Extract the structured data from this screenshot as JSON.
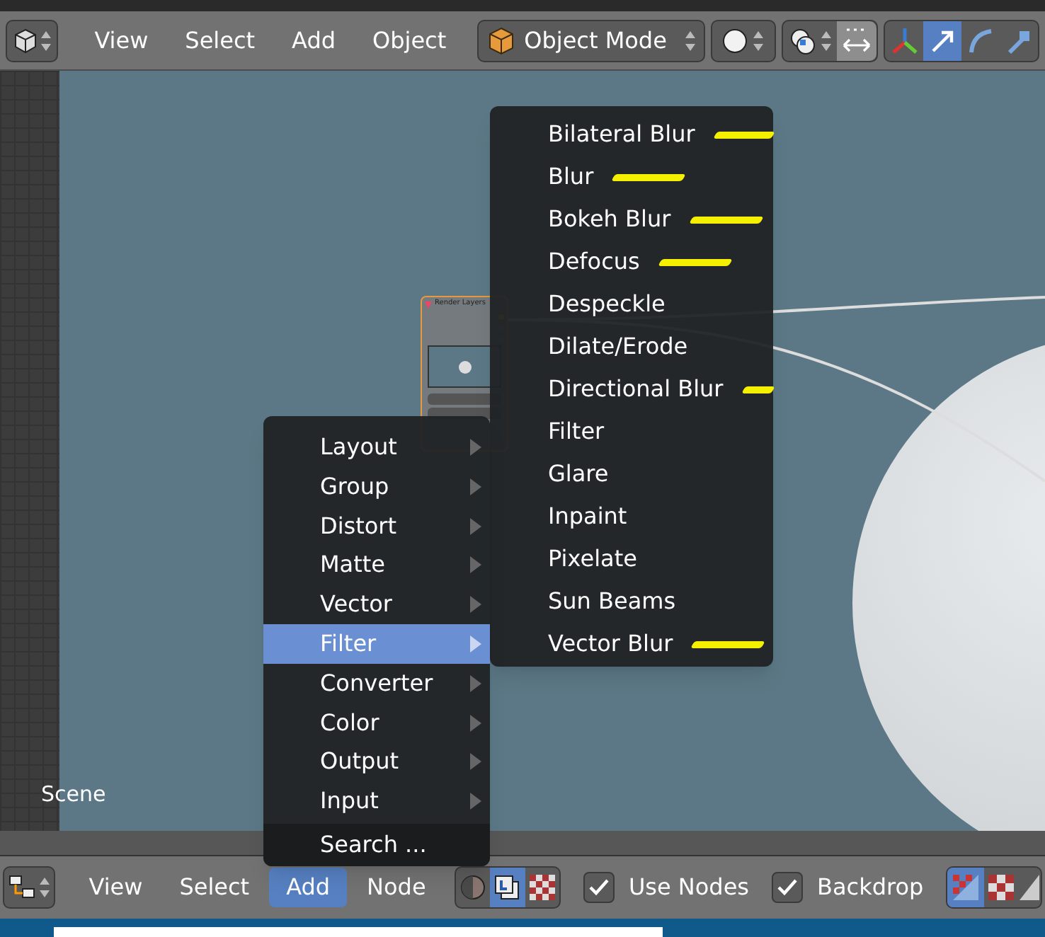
{
  "top_header": {
    "menus": [
      {
        "label": "View"
      },
      {
        "label": "Select"
      },
      {
        "label": "Add"
      },
      {
        "label": "Object"
      }
    ],
    "mode_dropdown": {
      "label": "Object Mode"
    }
  },
  "viewport": {
    "scene_label": "Scene",
    "node": {
      "title": "Render Layers"
    }
  },
  "add_menu": {
    "items": [
      {
        "label": "Layout",
        "kind": "submenu",
        "selected": false
      },
      {
        "label": "Group",
        "kind": "submenu",
        "selected": false
      },
      {
        "label": "Distort",
        "kind": "submenu",
        "selected": false
      },
      {
        "label": "Matte",
        "kind": "submenu",
        "selected": false
      },
      {
        "label": "Vector",
        "kind": "submenu",
        "selected": false
      },
      {
        "label": "Filter",
        "kind": "submenu",
        "selected": true
      },
      {
        "label": "Converter",
        "kind": "submenu",
        "selected": false
      },
      {
        "label": "Color",
        "kind": "submenu",
        "selected": false
      },
      {
        "label": "Output",
        "kind": "submenu",
        "selected": false
      },
      {
        "label": "Input",
        "kind": "submenu",
        "selected": false
      },
      {
        "label": "Search ...",
        "kind": "search"
      }
    ]
  },
  "filter_menu": {
    "items": [
      {
        "label": "Bilateral Blur",
        "marked": true
      },
      {
        "label": "Blur",
        "marked": true
      },
      {
        "label": "Bokeh Blur",
        "marked": true
      },
      {
        "label": "Defocus",
        "marked": true
      },
      {
        "label": "Despeckle",
        "marked": false
      },
      {
        "label": "Dilate/Erode",
        "marked": false
      },
      {
        "label": "Directional Blur",
        "marked": true
      },
      {
        "label": "Filter",
        "marked": false
      },
      {
        "label": "Glare",
        "marked": false
      },
      {
        "label": "Inpaint",
        "marked": false
      },
      {
        "label": "Pixelate",
        "marked": false
      },
      {
        "label": "Sun Beams",
        "marked": false
      },
      {
        "label": "Vector Blur",
        "marked": true
      }
    ]
  },
  "bottom_header": {
    "menus": [
      {
        "label": "View",
        "selected": false
      },
      {
        "label": "Select",
        "selected": false
      },
      {
        "label": "Add",
        "selected": true
      },
      {
        "label": "Node",
        "selected": false
      }
    ],
    "checkboxes": [
      {
        "label": "Use Nodes",
        "checked": true
      },
      {
        "label": "Backdrop",
        "checked": true
      }
    ]
  }
}
